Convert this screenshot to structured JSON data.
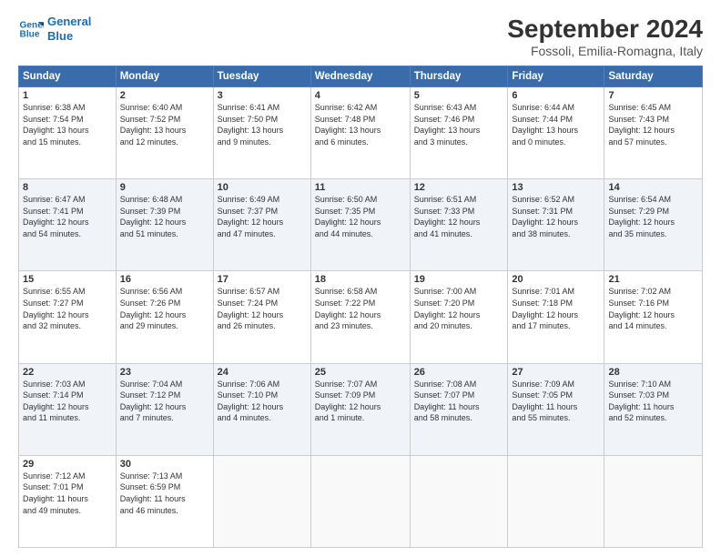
{
  "header": {
    "logo_line1": "General",
    "logo_line2": "Blue",
    "main_title": "September 2024",
    "subtitle": "Fossoli, Emilia-Romagna, Italy"
  },
  "days_of_week": [
    "Sunday",
    "Monday",
    "Tuesday",
    "Wednesday",
    "Thursday",
    "Friday",
    "Saturday"
  ],
  "weeks": [
    [
      {
        "day": "1",
        "info": "Sunrise: 6:38 AM\nSunset: 7:54 PM\nDaylight: 13 hours\nand 15 minutes."
      },
      {
        "day": "2",
        "info": "Sunrise: 6:40 AM\nSunset: 7:52 PM\nDaylight: 13 hours\nand 12 minutes."
      },
      {
        "day": "3",
        "info": "Sunrise: 6:41 AM\nSunset: 7:50 PM\nDaylight: 13 hours\nand 9 minutes."
      },
      {
        "day": "4",
        "info": "Sunrise: 6:42 AM\nSunset: 7:48 PM\nDaylight: 13 hours\nand 6 minutes."
      },
      {
        "day": "5",
        "info": "Sunrise: 6:43 AM\nSunset: 7:46 PM\nDaylight: 13 hours\nand 3 minutes."
      },
      {
        "day": "6",
        "info": "Sunrise: 6:44 AM\nSunset: 7:44 PM\nDaylight: 13 hours\nand 0 minutes."
      },
      {
        "day": "7",
        "info": "Sunrise: 6:45 AM\nSunset: 7:43 PM\nDaylight: 12 hours\nand 57 minutes."
      }
    ],
    [
      {
        "day": "8",
        "info": "Sunrise: 6:47 AM\nSunset: 7:41 PM\nDaylight: 12 hours\nand 54 minutes."
      },
      {
        "day": "9",
        "info": "Sunrise: 6:48 AM\nSunset: 7:39 PM\nDaylight: 12 hours\nand 51 minutes."
      },
      {
        "day": "10",
        "info": "Sunrise: 6:49 AM\nSunset: 7:37 PM\nDaylight: 12 hours\nand 47 minutes."
      },
      {
        "day": "11",
        "info": "Sunrise: 6:50 AM\nSunset: 7:35 PM\nDaylight: 12 hours\nand 44 minutes."
      },
      {
        "day": "12",
        "info": "Sunrise: 6:51 AM\nSunset: 7:33 PM\nDaylight: 12 hours\nand 41 minutes."
      },
      {
        "day": "13",
        "info": "Sunrise: 6:52 AM\nSunset: 7:31 PM\nDaylight: 12 hours\nand 38 minutes."
      },
      {
        "day": "14",
        "info": "Sunrise: 6:54 AM\nSunset: 7:29 PM\nDaylight: 12 hours\nand 35 minutes."
      }
    ],
    [
      {
        "day": "15",
        "info": "Sunrise: 6:55 AM\nSunset: 7:27 PM\nDaylight: 12 hours\nand 32 minutes."
      },
      {
        "day": "16",
        "info": "Sunrise: 6:56 AM\nSunset: 7:26 PM\nDaylight: 12 hours\nand 29 minutes."
      },
      {
        "day": "17",
        "info": "Sunrise: 6:57 AM\nSunset: 7:24 PM\nDaylight: 12 hours\nand 26 minutes."
      },
      {
        "day": "18",
        "info": "Sunrise: 6:58 AM\nSunset: 7:22 PM\nDaylight: 12 hours\nand 23 minutes."
      },
      {
        "day": "19",
        "info": "Sunrise: 7:00 AM\nSunset: 7:20 PM\nDaylight: 12 hours\nand 20 minutes."
      },
      {
        "day": "20",
        "info": "Sunrise: 7:01 AM\nSunset: 7:18 PM\nDaylight: 12 hours\nand 17 minutes."
      },
      {
        "day": "21",
        "info": "Sunrise: 7:02 AM\nSunset: 7:16 PM\nDaylight: 12 hours\nand 14 minutes."
      }
    ],
    [
      {
        "day": "22",
        "info": "Sunrise: 7:03 AM\nSunset: 7:14 PM\nDaylight: 12 hours\nand 11 minutes."
      },
      {
        "day": "23",
        "info": "Sunrise: 7:04 AM\nSunset: 7:12 PM\nDaylight: 12 hours\nand 7 minutes."
      },
      {
        "day": "24",
        "info": "Sunrise: 7:06 AM\nSunset: 7:10 PM\nDaylight: 12 hours\nand 4 minutes."
      },
      {
        "day": "25",
        "info": "Sunrise: 7:07 AM\nSunset: 7:09 PM\nDaylight: 12 hours\nand 1 minute."
      },
      {
        "day": "26",
        "info": "Sunrise: 7:08 AM\nSunset: 7:07 PM\nDaylight: 11 hours\nand 58 minutes."
      },
      {
        "day": "27",
        "info": "Sunrise: 7:09 AM\nSunset: 7:05 PM\nDaylight: 11 hours\nand 55 minutes."
      },
      {
        "day": "28",
        "info": "Sunrise: 7:10 AM\nSunset: 7:03 PM\nDaylight: 11 hours\nand 52 minutes."
      }
    ],
    [
      {
        "day": "29",
        "info": "Sunrise: 7:12 AM\nSunset: 7:01 PM\nDaylight: 11 hours\nand 49 minutes."
      },
      {
        "day": "30",
        "info": "Sunrise: 7:13 AM\nSunset: 6:59 PM\nDaylight: 11 hours\nand 46 minutes."
      },
      {
        "day": "",
        "info": ""
      },
      {
        "day": "",
        "info": ""
      },
      {
        "day": "",
        "info": ""
      },
      {
        "day": "",
        "info": ""
      },
      {
        "day": "",
        "info": ""
      }
    ]
  ]
}
